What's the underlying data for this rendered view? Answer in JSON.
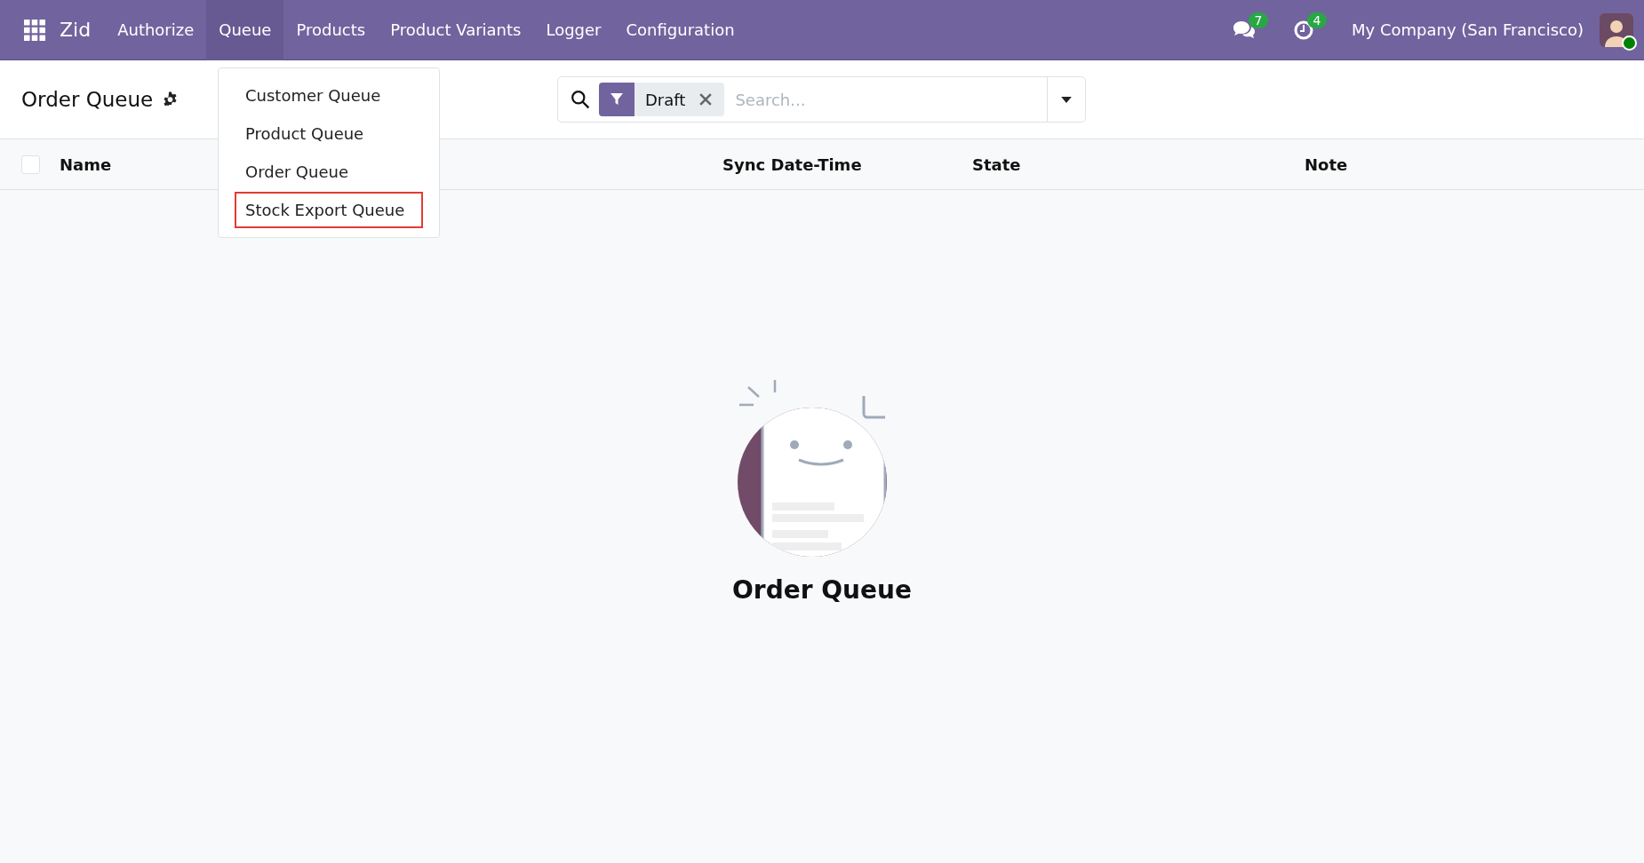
{
  "navbar": {
    "app_name": "Zid",
    "menu": [
      {
        "label": "Authorize",
        "selected": false
      },
      {
        "label": "Queue",
        "selected": true
      },
      {
        "label": "Products",
        "selected": false
      },
      {
        "label": "Product Variants",
        "selected": false
      },
      {
        "label": "Logger",
        "selected": false
      },
      {
        "label": "Configuration",
        "selected": false
      }
    ],
    "messages_count": "7",
    "activities_count": "4",
    "company": "My Company (San Francisco)",
    "user_online": true
  },
  "queue_dropdown": {
    "items": [
      {
        "label": "Customer Queue",
        "highlighted": false
      },
      {
        "label": "Product Queue",
        "highlighted": false
      },
      {
        "label": "Order Queue",
        "highlighted": false
      },
      {
        "label": "Stock Export Queue",
        "highlighted": true
      }
    ]
  },
  "control_panel": {
    "title": "Order Queue",
    "search": {
      "facets": [
        {
          "label": "Draft"
        }
      ],
      "placeholder": "Search..."
    }
  },
  "table": {
    "select_all_checked": false,
    "columns": [
      {
        "label": "Name"
      },
      {
        "label": "Sync Date-Time"
      },
      {
        "label": "State"
      },
      {
        "label": "Note"
      }
    ]
  },
  "empty_state": {
    "title": "Order Queue"
  }
}
